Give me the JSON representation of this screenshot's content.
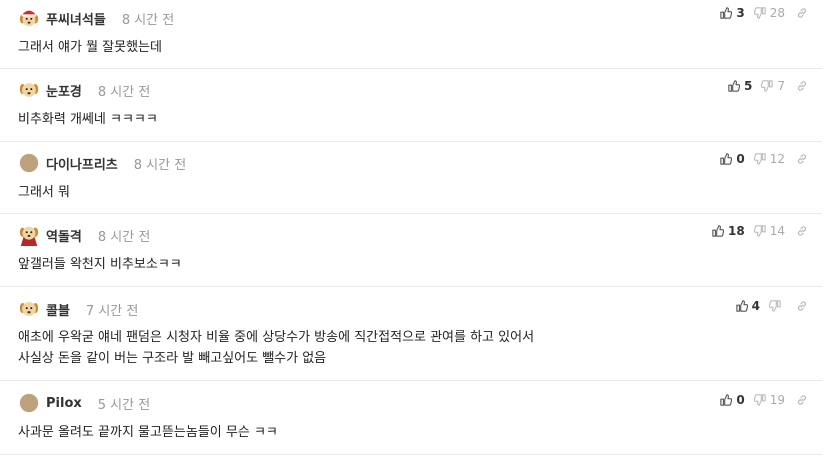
{
  "comments": [
    {
      "author": "푸씨녀석들",
      "time": "8 시간 전",
      "lines": [
        "그래서 얘가 뭘 잘못했는데"
      ],
      "upvotes": "3",
      "downvotes": "28",
      "avatar": "dog-santa-hat-icon"
    },
    {
      "author": "눈포경",
      "time": "8 시간 전",
      "lines": [
        "비추화력 개쎄네 ㅋㅋㅋㅋ"
      ],
      "upvotes": "5",
      "downvotes": "7",
      "avatar": "dog-icon"
    },
    {
      "author": "다이나프리츠",
      "time": "8 시간 전",
      "lines": [
        "그래서 뭐"
      ],
      "upvotes": "0",
      "downvotes": "12",
      "avatar": "circle-avatar-icon"
    },
    {
      "author": "역돌격",
      "time": "8 시간 전",
      "lines": [
        "앞갤러들 왁천지 비추보소ㅋㅋ"
      ],
      "upvotes": "18",
      "downvotes": "14",
      "avatar": "dog-red-cape-icon"
    },
    {
      "author": "콜블",
      "time": "7 시간 전",
      "lines": [
        "애초에 우왁굳 얘네 팬덤은 시청자 비율 중에 상당수가 방송에 직간접적으로 관여를 하고 있어서",
        "사실상 돈을 같이 버는 구조라 발 빼고싶어도 뺄수가 없음"
      ],
      "upvotes": "4",
      "downvotes": "",
      "avatar": "dog-icon"
    },
    {
      "author": "Pilox",
      "time": "5 시간 전",
      "lines": [
        "사과문 올려도 끝까지 물고뜯는놈들이 무슨 ㅋㅋ"
      ],
      "upvotes": "0",
      "downvotes": "19",
      "avatar": "circle-avatar-icon"
    }
  ],
  "icons": {
    "upvote": "thumbs-up-icon",
    "downvote": "thumbs-down-icon",
    "link": "link-icon"
  },
  "colors": {
    "upvote": "#555555",
    "downvote": "#bbbbbb",
    "link": "#bbbbbb"
  }
}
